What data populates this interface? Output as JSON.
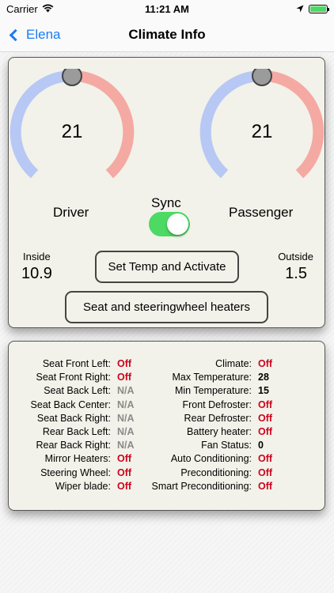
{
  "status_bar": {
    "carrier": "Carrier",
    "time": "11:21 AM",
    "battery_color": "#4cd964"
  },
  "nav": {
    "back_label": "Elena",
    "title": "Climate Info"
  },
  "climate": {
    "driver": {
      "label": "Driver",
      "temperature": "21",
      "setting": 0.5
    },
    "passenger": {
      "label": "Passenger",
      "temperature": "21",
      "setting": 0.5
    },
    "sync": {
      "label": "Sync",
      "on": true
    },
    "inside": {
      "label": "Inside",
      "value": "10.9"
    },
    "outside": {
      "label": "Outside",
      "value": "1.5"
    },
    "buttons": {
      "activate": "Set Temp and Activate",
      "heaters": "Seat and steeringwheel heaters"
    },
    "colors": {
      "cold": "#b8c8f5",
      "hot": "#f5a9a3",
      "knob": "#9b9b9b"
    }
  },
  "status_table": {
    "left": [
      {
        "label": "Seat Front Left:",
        "value": "Off",
        "kind": "off"
      },
      {
        "label": "Seat Front Right:",
        "value": "Off",
        "kind": "off"
      },
      {
        "label": "Seat Back Left:",
        "value": "N/A",
        "kind": "na"
      },
      {
        "label": "Seat Back Center:",
        "value": "N/A",
        "kind": "na"
      },
      {
        "label": "Seat Back Right:",
        "value": "N/A",
        "kind": "na"
      },
      {
        "label": "Rear Back Left:",
        "value": "N/A",
        "kind": "na"
      },
      {
        "label": "Rear Back Right:",
        "value": "N/A",
        "kind": "na"
      },
      {
        "label": "Mirror Heaters:",
        "value": "Off",
        "kind": "off"
      },
      {
        "label": "Steering Wheel:",
        "value": "Off",
        "kind": "off"
      },
      {
        "label": "Wiper blade:",
        "value": "Off",
        "kind": "off"
      }
    ],
    "right": [
      {
        "label": "Climate:",
        "value": "Off",
        "kind": "off"
      },
      {
        "label": "Max Temperature:",
        "value": "28",
        "kind": "num"
      },
      {
        "label": "Min Temperature:",
        "value": "15",
        "kind": "num"
      },
      {
        "label": "Front Defroster:",
        "value": "Off",
        "kind": "off"
      },
      {
        "label": "Rear Defroster:",
        "value": "Off",
        "kind": "off"
      },
      {
        "label": "Battery heater:",
        "value": "Off",
        "kind": "off"
      },
      {
        "label": "Fan Status:",
        "value": "0",
        "kind": "num"
      },
      {
        "label": "Auto Conditioning:",
        "value": "Off",
        "kind": "off"
      },
      {
        "label": "Preconditioning:",
        "value": "Off",
        "kind": "off"
      },
      {
        "label": "Smart Preconditioning:",
        "value": "Off",
        "kind": "off"
      }
    ]
  }
}
